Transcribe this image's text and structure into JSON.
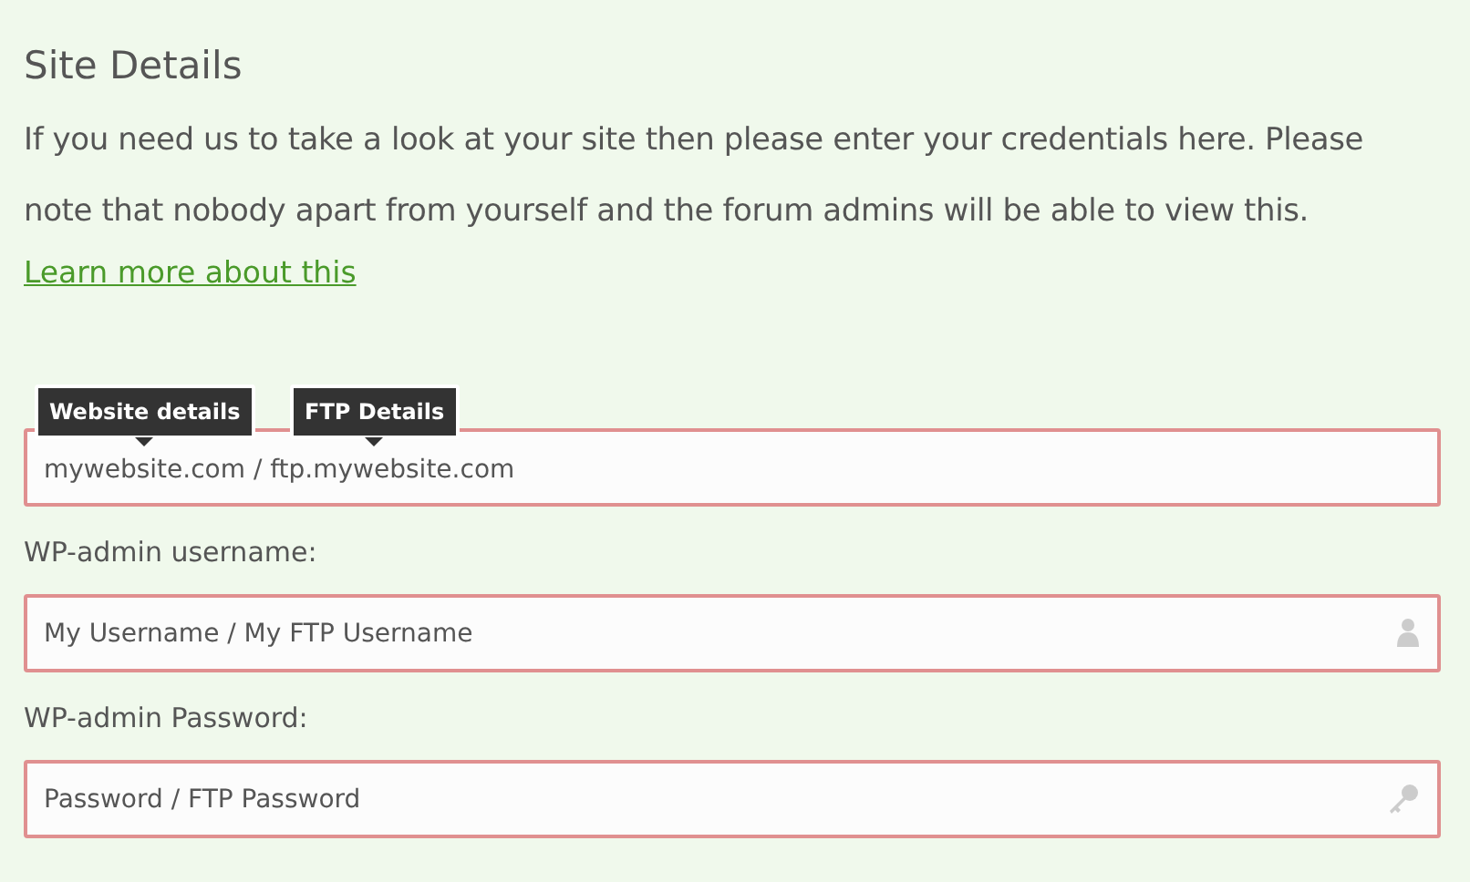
{
  "section_title": "Site Details",
  "intro": "If you need us to take a look at your site then please enter your credentials here. Please note that nobody apart from yourself and the forum admins will be able to view this.",
  "learn_more_link": "Learn more about this",
  "fields": [
    {
      "kind": "url",
      "placeholder": "mywebsite.com / ftp.mywebsite.com",
      "tooltips": [
        "Website details",
        "FTP Details"
      ]
    },
    {
      "kind": "username",
      "label": "WP-admin username:",
      "placeholder": "My Username / My FTP Username"
    },
    {
      "kind": "password",
      "label": "WP-admin Password:",
      "placeholder": "Password / FTP Password"
    }
  ]
}
